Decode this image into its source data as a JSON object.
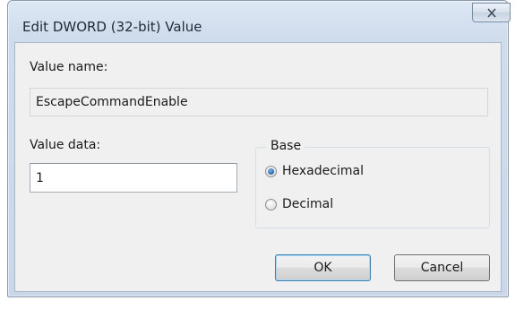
{
  "window": {
    "title": "Edit DWORD (32-bit) Value",
    "close_icon": "close-x-icon"
  },
  "value_name": {
    "label": "Value name:",
    "value": "EscapeCommandEnable"
  },
  "value_data": {
    "label": "Value data:",
    "value": "1"
  },
  "base": {
    "legend": "Base",
    "options": [
      {
        "label": "Hexadecimal",
        "selected": true
      },
      {
        "label": "Decimal",
        "selected": false
      }
    ]
  },
  "buttons": {
    "ok_label": "OK",
    "cancel_label": "Cancel"
  },
  "colors": {
    "title_bar": "#cfdcec",
    "client_bg": "#f0f0f0",
    "radio_selected": "#2f6fb2"
  }
}
